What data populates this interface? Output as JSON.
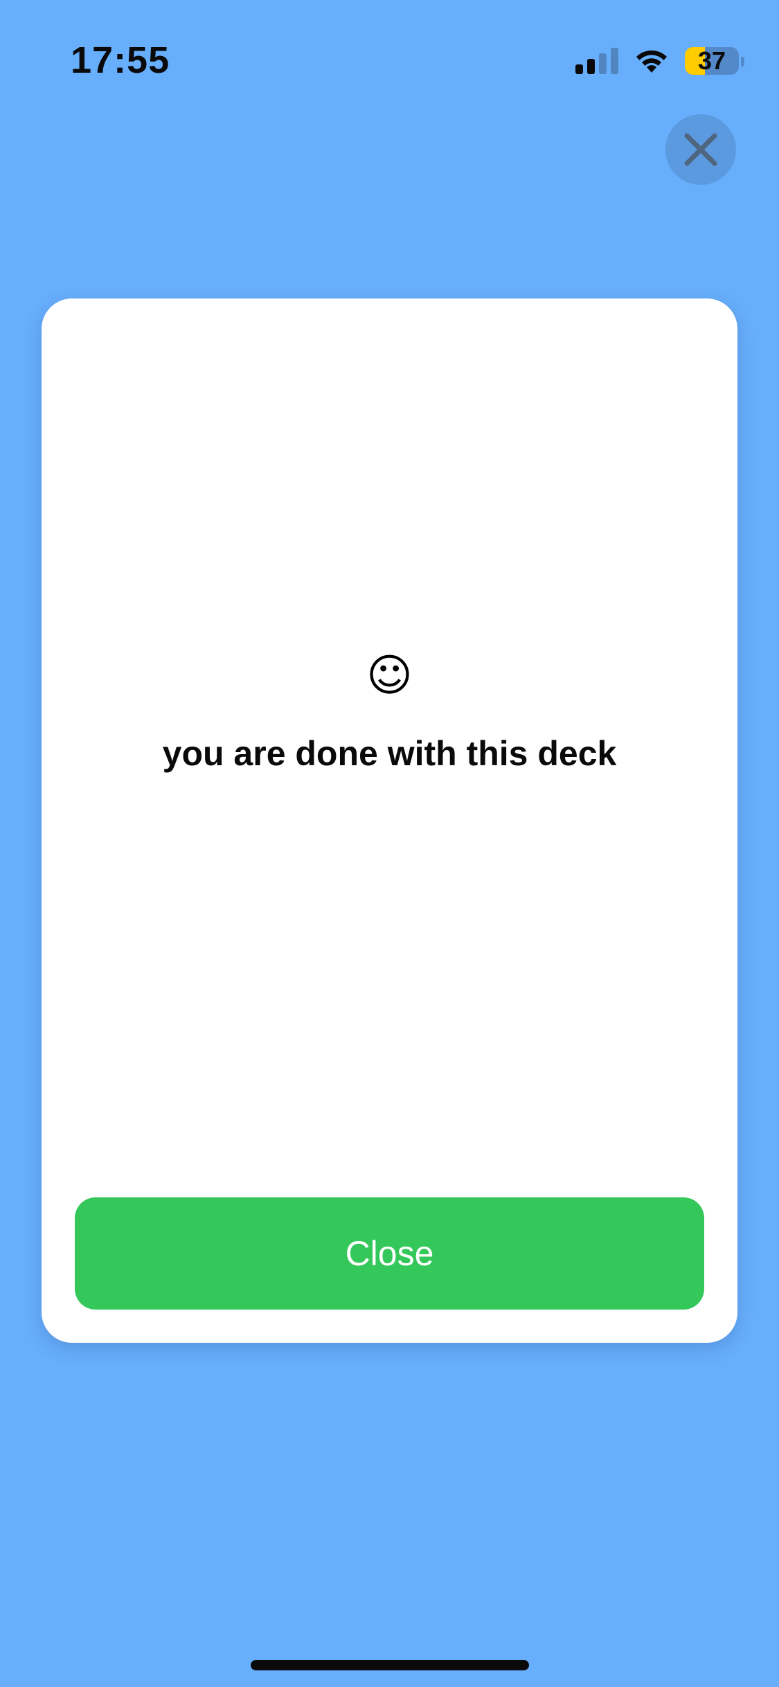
{
  "status_bar": {
    "time": "17:55",
    "battery_level": "37",
    "battery_fraction": 0.37,
    "signal_bars_active": 2,
    "signal_bars_total": 4,
    "icons": [
      "cellular-signal-icon",
      "wifi-icon",
      "battery-icon"
    ]
  },
  "dismiss": {
    "icon": "close-icon"
  },
  "card": {
    "emoji": "☺",
    "message": "you are done with this deck",
    "close_label": "Close"
  },
  "colors": {
    "background": "#67aefc",
    "card": "#ffffff",
    "button": "#34c759",
    "battery_fill": "#ffcc00"
  }
}
